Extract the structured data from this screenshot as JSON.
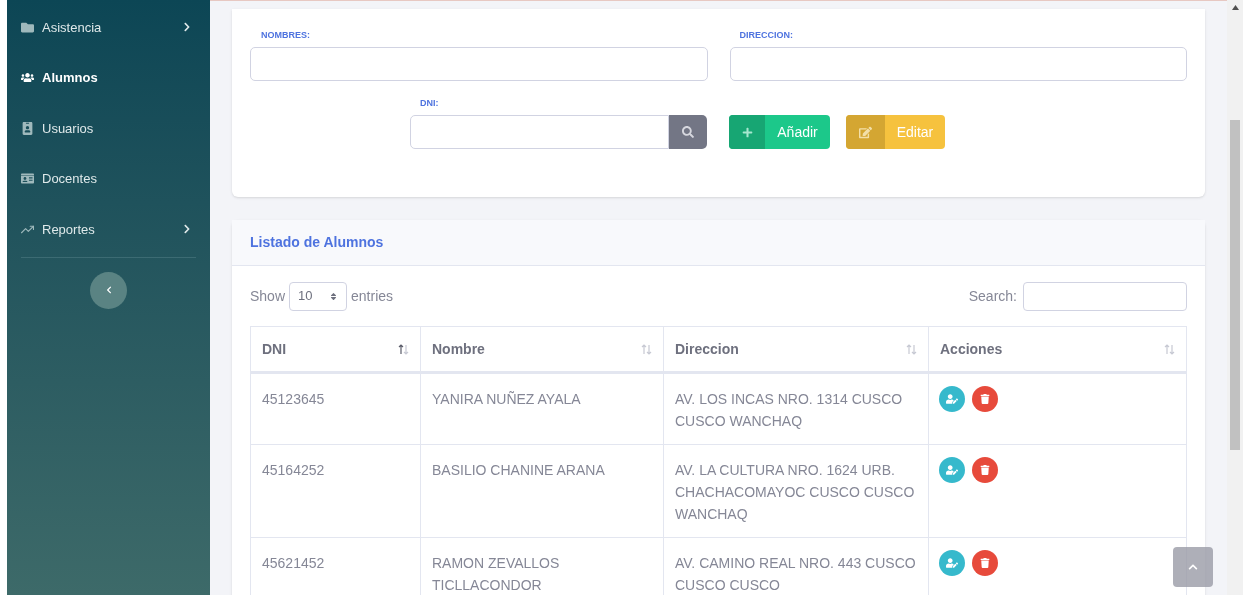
{
  "sidebar": {
    "items": [
      {
        "label": "Asistencia",
        "selected": false,
        "submenu": true
      },
      {
        "label": "Alumnos",
        "selected": true,
        "submenu": false
      },
      {
        "label": "Usuarios",
        "selected": false,
        "submenu": false
      },
      {
        "label": "Docentes",
        "selected": false,
        "submenu": false
      },
      {
        "label": "Reportes",
        "selected": false,
        "submenu": true
      }
    ]
  },
  "form": {
    "nombres_label": "NOMBRES:",
    "direccion_label": "DIRECCION:",
    "dni_label": "DNI:",
    "add_button": "Añadir",
    "edit_button": "Editar"
  },
  "list": {
    "title": "Listado de Alumnos",
    "show_label": "Show",
    "page_size": "10",
    "entries_label": "entries",
    "search_label": "Search:",
    "columns": [
      {
        "label": "DNI",
        "sorted": true
      },
      {
        "label": "Nombre",
        "sorted": false
      },
      {
        "label": "Direccion",
        "sorted": false
      },
      {
        "label": "Acciones",
        "sorted": false
      }
    ],
    "rows": [
      {
        "dni": "45123645",
        "nombre": "YANIRA NUÑEZ AYALA",
        "direccion": "AV. LOS INCAS NRO. 1314 CUSCO CUSCO WANCHAQ"
      },
      {
        "dni": "45164252",
        "nombre": "BASILIO CHANINE ARANA",
        "direccion": "AV. LA CULTURA NRO. 1624 URB. CHACHACOMAYOC CUSCO CUSCO WANCHAQ"
      },
      {
        "dni": "45621452",
        "nombre": "RAMON ZEVALLOS TICLLACONDOR",
        "direccion": "AV. CAMINO REAL NRO. 443 CUSCO CUSCO CUSCO"
      }
    ]
  }
}
